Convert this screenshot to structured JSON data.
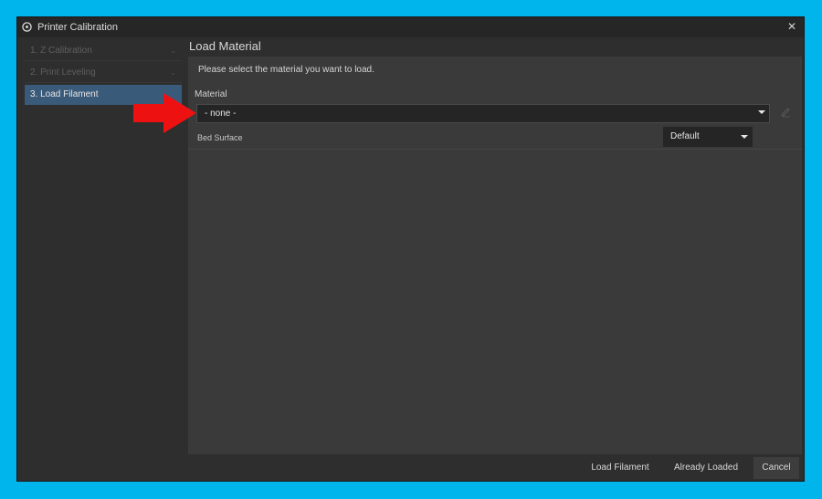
{
  "window": {
    "title": "Printer Calibration",
    "app_icon": "cura-logo-icon",
    "close_icon": "close-icon",
    "close_glyph": "✕"
  },
  "sidebar": {
    "steps": [
      {
        "label": "1. Z Calibration",
        "state": "done"
      },
      {
        "label": "2. Print Leveling",
        "state": "done"
      },
      {
        "label": "3. Load Filament",
        "state": "active"
      }
    ]
  },
  "main": {
    "section_title": "Load Material",
    "instructions": "Please select the material you want to load.",
    "material": {
      "label": "Material",
      "value": "- none -"
    },
    "bed_surface": {
      "label": "Bed Surface",
      "value": "Default"
    }
  },
  "footer": {
    "load_label": "Load Filament",
    "already_label": "Already Loaded",
    "cancel_label": "Cancel"
  },
  "colors": {
    "accent": "#3a5a7a",
    "highlight_arrow": "#ee1111",
    "backdrop": "#00b4ec"
  }
}
